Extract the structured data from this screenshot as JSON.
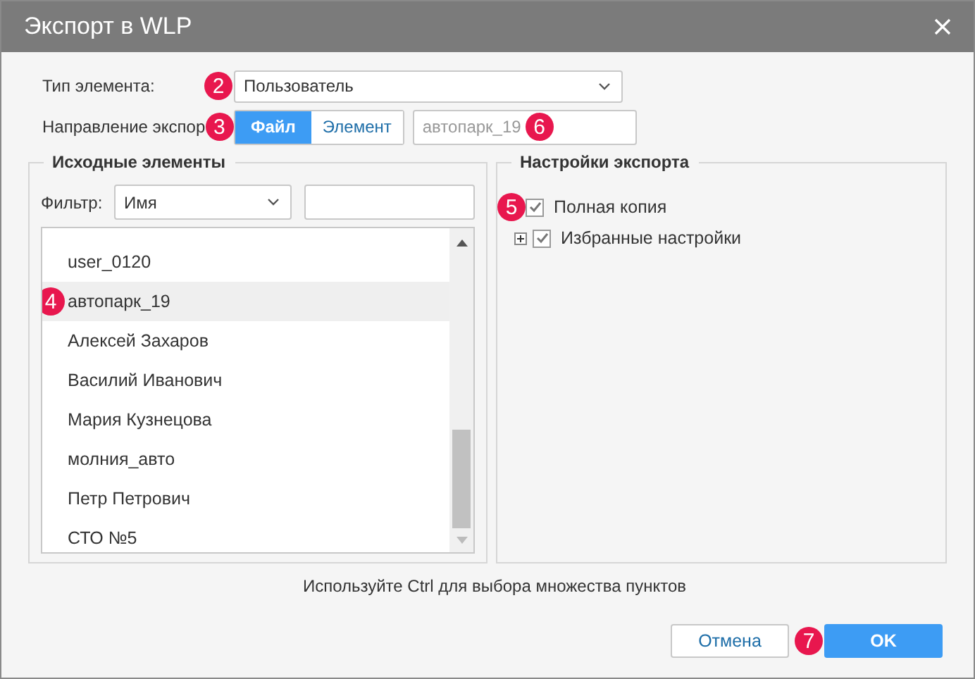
{
  "window": {
    "title": "Экспорт в WLP"
  },
  "element_type": {
    "label": "Тип элемента:",
    "value": "Пользователь",
    "marker": "2"
  },
  "direction": {
    "label": "Направление экспор",
    "marker": "3",
    "options": [
      {
        "label": "Файл",
        "selected": true
      },
      {
        "label": "Элемент",
        "selected": false
      }
    ],
    "target": {
      "value": "автопарк_19",
      "marker": "6"
    }
  },
  "source": {
    "title": "Исходные элементы",
    "filter_label": "Фильтр:",
    "filter_value": "Имя",
    "items": [
      {
        "label": "user_0120",
        "selected": false
      },
      {
        "label": "автопарк_19",
        "selected": true,
        "marker": "4"
      },
      {
        "label": "Алексей Захаров",
        "selected": false
      },
      {
        "label": "Василий Иванович",
        "selected": false
      },
      {
        "label": "Мария Кузнецова",
        "selected": false
      },
      {
        "label": "молния_авто",
        "selected": false
      },
      {
        "label": "Петр Петрович",
        "selected": false
      },
      {
        "label": "СТО №5",
        "selected": false
      }
    ]
  },
  "settings": {
    "title": "Настройки экспорта",
    "items": [
      {
        "label": "Полная копия",
        "checked": true,
        "expandable": false,
        "marker": "5"
      },
      {
        "label": "Избранные настройки",
        "checked": true,
        "expandable": true
      }
    ]
  },
  "hint": "Используйте Ctrl для выбора множества пунктов",
  "buttons": [
    {
      "label": "Отмена",
      "kind": "secondary"
    },
    {
      "label": "OK",
      "kind": "primary",
      "marker": "7"
    }
  ]
}
